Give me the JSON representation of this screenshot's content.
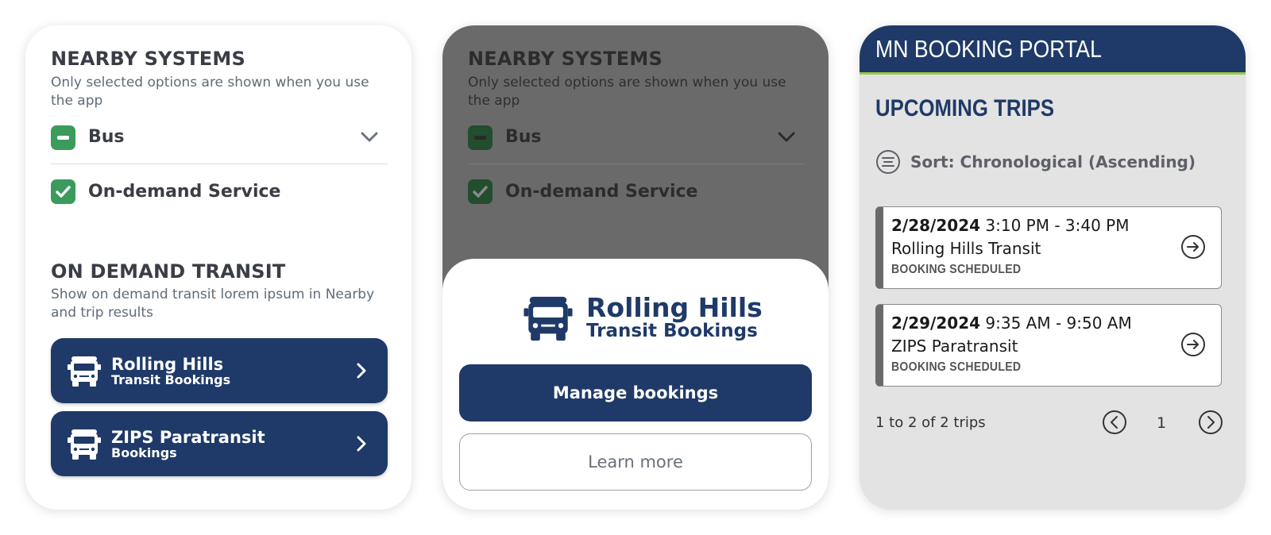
{
  "panel1": {
    "nearby_title": "NEARBY SYSTEMS",
    "nearby_sub": "Only selected options are shown when you use the app",
    "options": [
      {
        "label": "Bus",
        "state": "partial",
        "icon": "minus-checkbox-icon"
      },
      {
        "label": "On-demand Service",
        "state": "checked",
        "icon": "check-checkbox-icon"
      }
    ],
    "ondemand_title": "ON DEMAND TRANSIT",
    "ondemand_sub": "Show on demand transit lorem ipsum in Nearby and trip results",
    "agencies": [
      {
        "name": "Rolling Hills",
        "sub": "Transit Bookings",
        "icon": "van-icon"
      },
      {
        "name": "ZIPS Paratransit",
        "sub": "Bookings",
        "icon": "van-icon"
      }
    ]
  },
  "panel2": {
    "nearby_title": "NEARBY SYSTEMS",
    "nearby_sub": "Only selected options are shown when you use the app",
    "options": [
      {
        "label": "Bus"
      },
      {
        "label": "On-demand Service"
      }
    ],
    "sheet": {
      "logo_line1": "Rolling Hills",
      "logo_line2": "Transit Bookings",
      "primary_button": "Manage bookings",
      "secondary_button": "Learn more"
    }
  },
  "panel3": {
    "header_title": "MN BOOKING PORTAL",
    "section_title": "UPCOMING TRIPS",
    "sort_label": "Sort: Chronological (Ascending)",
    "trips": [
      {
        "date": "2/28/2024",
        "time": "3:10 PM - 3:40 PM",
        "agency": "Rolling Hills Transit",
        "status": "BOOKING SCHEDULED"
      },
      {
        "date": "2/29/2024",
        "time": "9:35 AM - 9:50 AM",
        "agency": "ZIPS Paratransit",
        "status": "BOOKING SCHEDULED"
      }
    ],
    "pager_count": "1 to 2 of 2 trips",
    "current_page": "1"
  },
  "colors": {
    "navy": "#1f3a68",
    "checkbox_green": "#3b9b5c",
    "header_accent": "#9cc84b"
  }
}
